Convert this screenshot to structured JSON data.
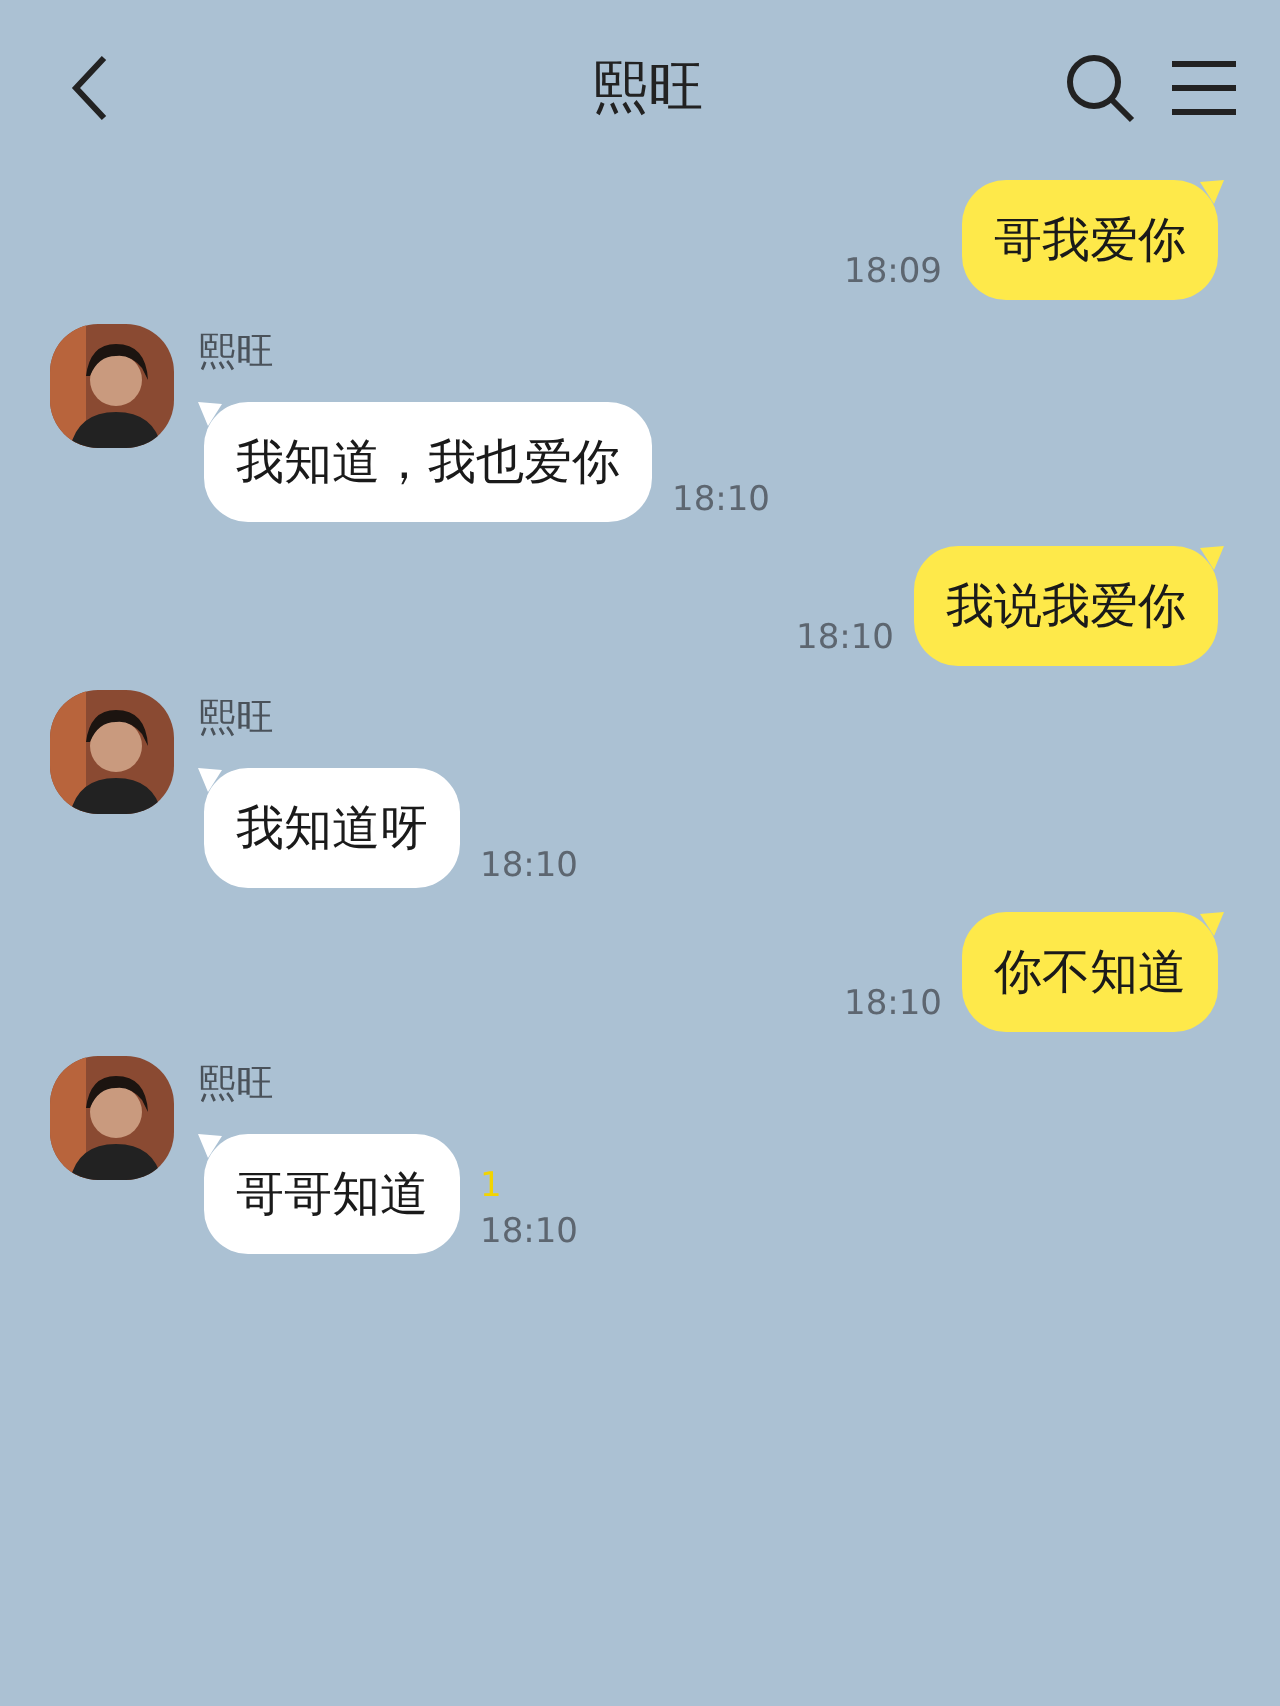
{
  "header": {
    "title": "熙旺"
  },
  "messages": [
    {
      "kind": "sent",
      "text": "哥我爱你",
      "time": "18:09"
    },
    {
      "kind": "received",
      "sender": "熙旺",
      "text": "我知道，我也爱你",
      "time": "18:10"
    },
    {
      "kind": "sent",
      "text": "我说我爱你",
      "time": "18:10"
    },
    {
      "kind": "received",
      "sender": "熙旺",
      "text": "我知道呀",
      "time": "18:10"
    },
    {
      "kind": "sent",
      "text": "你不知道",
      "time": "18:10"
    },
    {
      "kind": "received",
      "sender": "熙旺",
      "text": "哥哥知道",
      "unread": "1",
      "time": "18:10"
    }
  ]
}
